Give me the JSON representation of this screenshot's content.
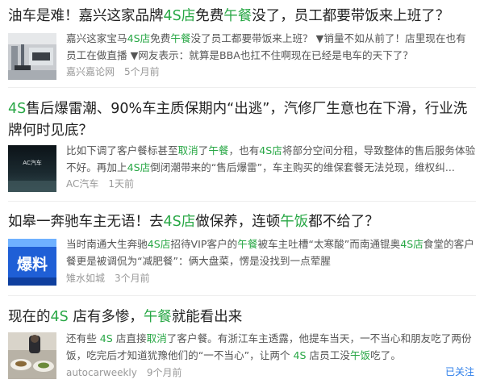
{
  "items": [
    {
      "title": [
        {
          "t": "油车是难！嘉兴这家品牌"
        },
        {
          "t": "4S店",
          "hl": true
        },
        {
          "t": "免费"
        },
        {
          "t": "午餐",
          "hl": true
        },
        {
          "t": "没了，员工都要带饭来上班了？"
        }
      ],
      "snippet": [
        {
          "t": "嘉兴这家宝马"
        },
        {
          "t": "4S店",
          "hl": true
        },
        {
          "t": "免费"
        },
        {
          "t": "午餐",
          "hl": true
        },
        {
          "t": "没了员工都要带饭来上班？ ▼销量不如从前了！店里现在也有员工在做直播 ▼网友表示：就算是BBA也扛不住啊现在已经是电车的天下了？"
        }
      ],
      "source": "嘉兴嘉论网",
      "time": "5个月前"
    },
    {
      "title": [
        {
          "t": "4S",
          "hl": true
        },
        {
          "t": "售后爆雷潮、90%车主质保期内“出逃”，汽修厂生意也在下滑，行业洗牌何时见底？"
        }
      ],
      "snippet": [
        {
          "t": "比如下调了客户餐标甚至"
        },
        {
          "t": "取消",
          "hl": true
        },
        {
          "t": "了"
        },
        {
          "t": "午餐",
          "hl": true
        },
        {
          "t": "，也有"
        },
        {
          "t": "4S店",
          "hl": true
        },
        {
          "t": "将部分空间分租，导致整体的售后服务体验不好。再加上"
        },
        {
          "t": "4S店",
          "hl": true
        },
        {
          "t": "倒闭潮带来的“售后爆雷”，车主购买的维保套餐无法兑现，维权纠..."
        }
      ],
      "source": "AC汽车",
      "time": "1天前",
      "thumb_text": "AC汽车"
    },
    {
      "title": [
        {
          "t": "如皋一奔驰车主无语！去"
        },
        {
          "t": "4S店",
          "hl": true
        },
        {
          "t": "做保养，连顿"
        },
        {
          "t": "午饭",
          "hl": true
        },
        {
          "t": "都不给了？"
        }
      ],
      "snippet": [
        {
          "t": "当时南通大生奔驰"
        },
        {
          "t": "4S店",
          "hl": true
        },
        {
          "t": "招待VIP客户的"
        },
        {
          "t": "午餐",
          "hl": true
        },
        {
          "t": "被车主吐槽“太寒酸”而南通锟奥"
        },
        {
          "t": "4S店",
          "hl": true
        },
        {
          "t": "食堂的客户餐更是被调侃为“减肥餐”：俩大盘菜，愣是没找到一点荤腥"
        }
      ],
      "source": "雉水如城",
      "time": "3个月前",
      "thumb_text": "爆料"
    },
    {
      "title": [
        {
          "t": "现在的"
        },
        {
          "t": "4S",
          "hl": true
        },
        {
          "t": " 店有多惨，"
        },
        {
          "t": "午餐",
          "hl": true
        },
        {
          "t": "就能看出来"
        }
      ],
      "snippet": [
        {
          "t": "还有些 "
        },
        {
          "t": "4S",
          "hl": true
        },
        {
          "t": " 店直接"
        },
        {
          "t": "取消",
          "hl": true
        },
        {
          "t": "了客户餐。有浙江车主透露，他提车当天，一不当心和朋友吃了两份饭，吃完后才知道犹豫他们的“一不当心”，让两个 "
        },
        {
          "t": "4S",
          "hl": true
        },
        {
          "t": " 店员工没"
        },
        {
          "t": "午饭",
          "hl": true
        },
        {
          "t": "吃了。"
        }
      ],
      "source": "autocarweekly",
      "time": "9个月前"
    }
  ],
  "follow_label": "已关注",
  "colors": {
    "highlight": "#28a745",
    "link": "#2b7de9",
    "meta": "#999999"
  }
}
